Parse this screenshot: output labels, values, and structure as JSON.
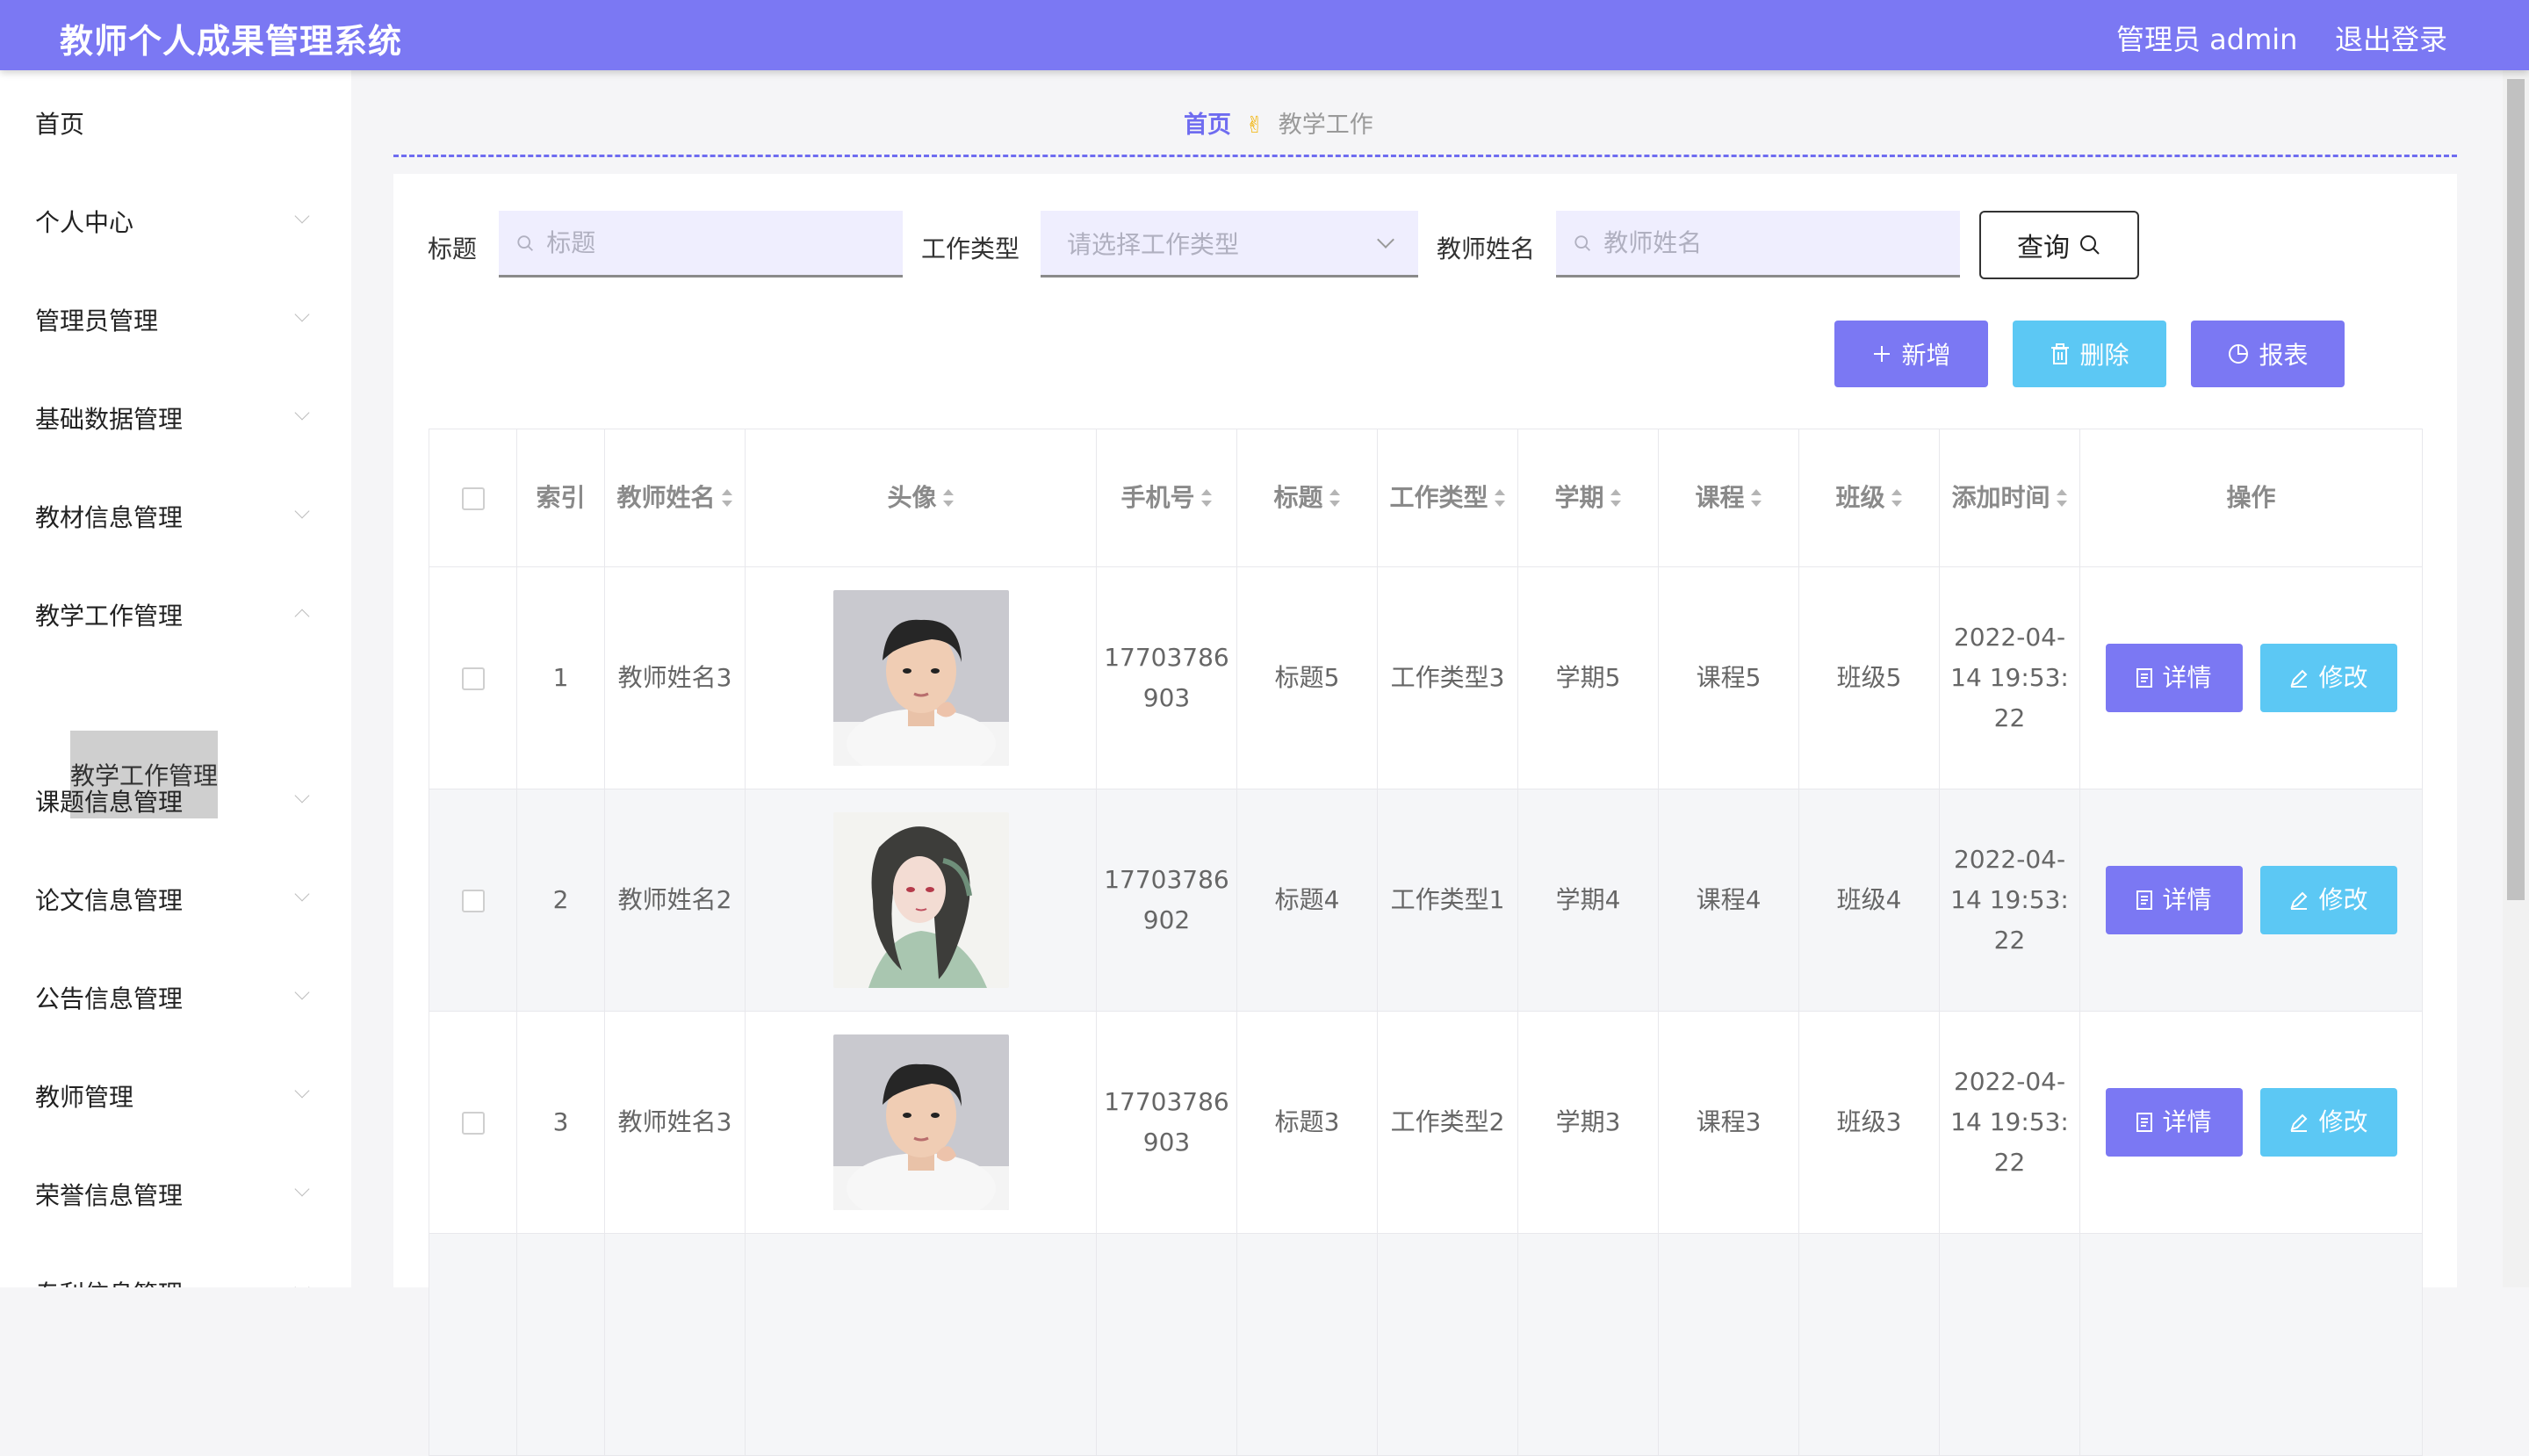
{
  "header": {
    "title": "教师个人成果管理系统",
    "user": "管理员 admin",
    "logout": "退出登录",
    "color": "#7b78f3"
  },
  "sidebar": {
    "items": [
      {
        "label": "首页"
      },
      {
        "label": "个人中心"
      },
      {
        "label": "管理员管理"
      },
      {
        "label": "基础数据管理"
      },
      {
        "label": "教材信息管理"
      },
      {
        "label": "教学工作管理"
      },
      {
        "label": "课题信息管理"
      },
      {
        "label": "论文信息管理"
      },
      {
        "label": "公告信息管理"
      },
      {
        "label": "教师管理"
      },
      {
        "label": "荣誉信息管理"
      },
      {
        "label": "专利信息管理"
      }
    ],
    "active_sub": "教学工作管理"
  },
  "breadcrumb": {
    "home": "首页",
    "separator": "✌",
    "current": "教学工作"
  },
  "search": {
    "title_label": "标题",
    "title_placeholder": "标题",
    "type_label": "工作类型",
    "type_placeholder": "请选择工作类型",
    "teacher_label": "教师姓名",
    "teacher_placeholder": "教师姓名",
    "query_button": "查询"
  },
  "actions": {
    "add": "新增",
    "delete": "删除",
    "report": "报表",
    "add_color": "#7b78f3",
    "delete_color": "#5cc8f4",
    "report_color": "#7b78f3"
  },
  "table": {
    "columns": [
      "索引",
      "教师姓名",
      "头像",
      "手机号",
      "标题",
      "工作类型",
      "学期",
      "课程",
      "班级",
      "添加时间",
      "操作"
    ],
    "rows": [
      {
        "index": "1",
        "teacher": "教师姓名3",
        "phone": "17703786903",
        "title": "标题5",
        "type": "工作类型3",
        "term": "学期5",
        "course": "课程5",
        "class": "班级5",
        "time": "2022-04-14 19:53:22",
        "avatar": "male"
      },
      {
        "index": "2",
        "teacher": "教师姓名2",
        "phone": "17703786902",
        "title": "标题4",
        "type": "工作类型1",
        "term": "学期4",
        "course": "课程4",
        "class": "班级4",
        "time": "2022-04-14 19:53:22",
        "avatar": "female"
      },
      {
        "index": "3",
        "teacher": "教师姓名3",
        "phone": "17703786903",
        "title": "标题3",
        "type": "工作类型2",
        "term": "学期3",
        "course": "课程3",
        "class": "班级3",
        "time": "2022-04-14 19:53:22",
        "avatar": "male"
      }
    ],
    "detail_label": "详情",
    "edit_label": "修改"
  }
}
